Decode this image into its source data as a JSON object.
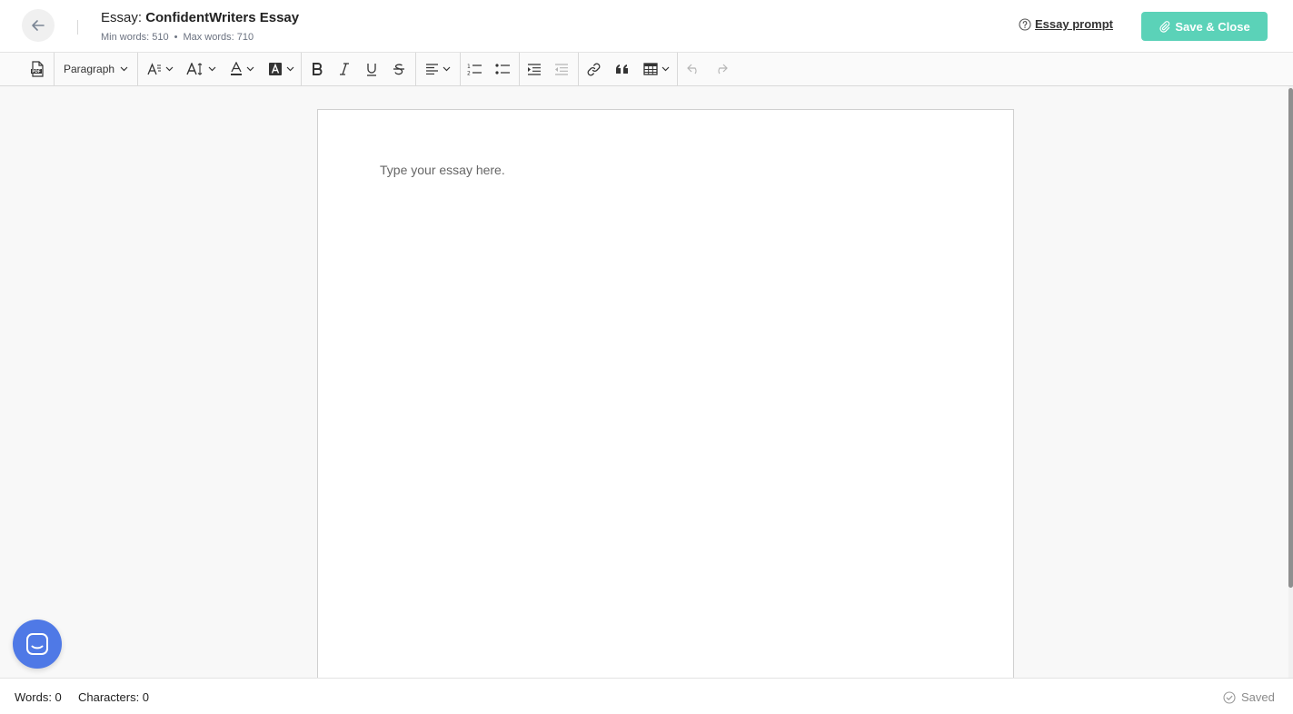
{
  "header": {
    "title_prefix": "Essay: ",
    "title_name": "ConfidentWriters Essay",
    "min_words": "Min words: 510",
    "separator": "•",
    "max_words": "Max words: 710",
    "prompt_link": "Essay prompt",
    "save_label": "Save & Close"
  },
  "toolbar": {
    "paragraph_label": "Paragraph"
  },
  "editor": {
    "placeholder": "Type your essay here."
  },
  "footer": {
    "words": "Words: 0",
    "characters": "Characters: 0",
    "status": "Saved"
  },
  "colors": {
    "accent": "#5bd2b8",
    "chat": "#4f79e6"
  },
  "icons": [
    "arrow-left-icon",
    "question-circle-icon",
    "paperclip-icon",
    "pdf-icon",
    "chevron-down-icon",
    "font-family-icon",
    "font-size-icon",
    "font-color-icon",
    "highlight-icon",
    "bold-icon",
    "italic-icon",
    "underline-icon",
    "strikethrough-icon",
    "align-left-icon",
    "numbered-list-icon",
    "bulleted-list-icon",
    "indent-icon",
    "outdent-icon",
    "link-icon",
    "quote-icon",
    "table-icon",
    "undo-icon",
    "redo-icon",
    "chat-icon",
    "check-circle-icon"
  ]
}
